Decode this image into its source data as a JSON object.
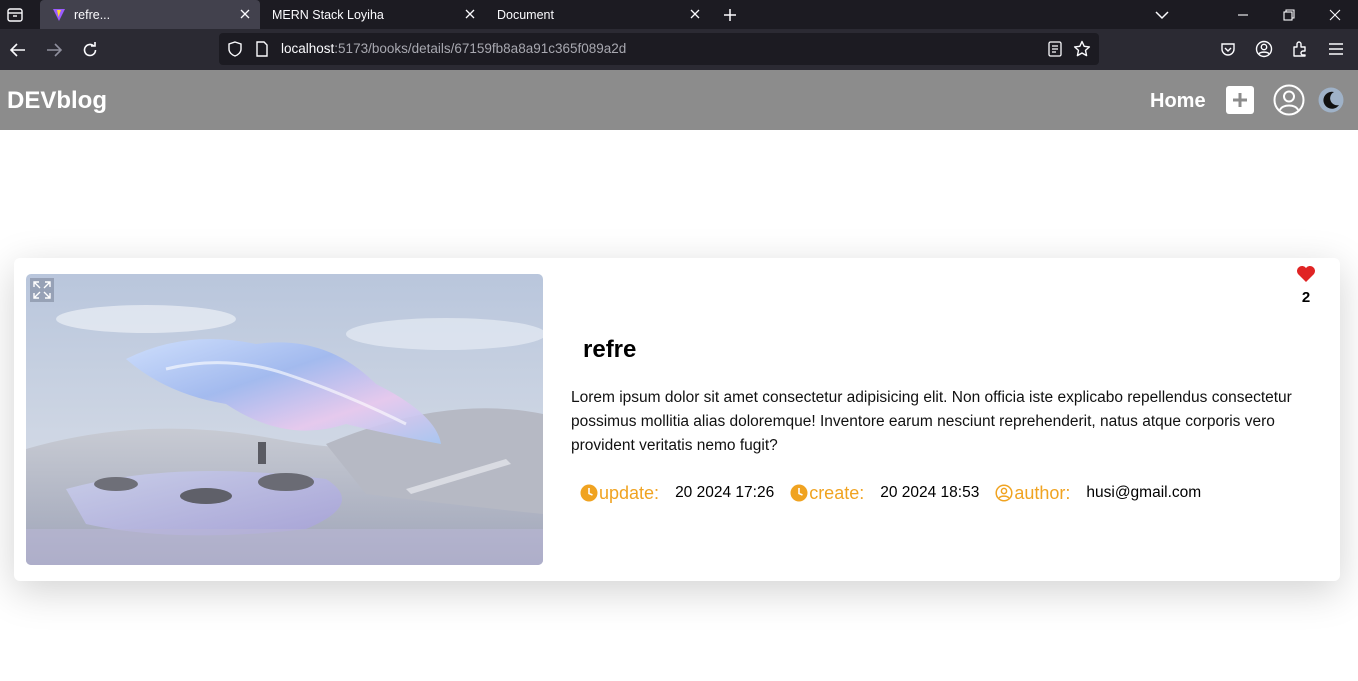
{
  "browser": {
    "tabs": [
      {
        "title": "refre...",
        "active": true
      },
      {
        "title": "MERN Stack Loyiha",
        "active": false
      },
      {
        "title": "Document",
        "active": false
      }
    ],
    "url_host": "localhost",
    "url_path": ":5173/books/details/67159fb8a8a91c365f089a2d"
  },
  "header": {
    "brand": "DEVblog",
    "home_label": "Home",
    "background_color": "#8c8c8c"
  },
  "post": {
    "title": "refre",
    "description": "Lorem ipsum dolor sit amet consectetur adipisicing elit. Non officia iste explicabo repellendus consectetur possimus mollitia alias doloremque! Inventore earum nesciunt reprehenderit, natus atque corporis vero provident veritatis nemo fugit?",
    "likes": "2",
    "meta": {
      "update_label": "update:",
      "update_value": "20 2024 17:26",
      "create_label": "create:",
      "create_value": "20 2024 18:53",
      "author_label": "author:",
      "author_value": "husi@gmail.com"
    },
    "accent_color": "#f0a321",
    "like_color": "#e02424"
  }
}
